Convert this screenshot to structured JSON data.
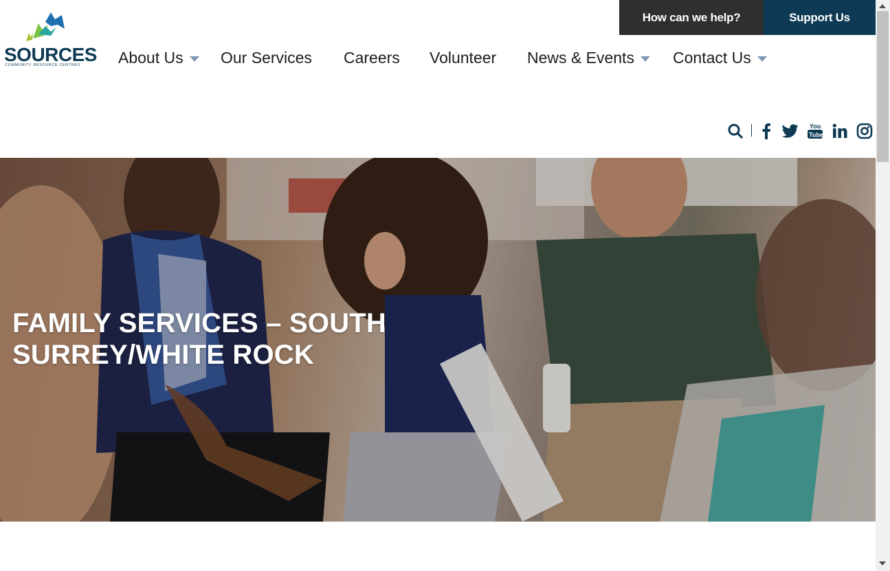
{
  "header": {
    "logo": {
      "name": "SOURCES",
      "tagline": "COMMUNITY RESOURCE CENTRES"
    },
    "top_buttons": {
      "help": "How can we help?",
      "support": "Support Us"
    },
    "nav": [
      {
        "label": "About Us",
        "has_dropdown": true
      },
      {
        "label": "Our Services",
        "has_dropdown": false
      },
      {
        "label": "Careers",
        "has_dropdown": false
      },
      {
        "label": "Volunteer",
        "has_dropdown": false
      },
      {
        "label": "News & Events",
        "has_dropdown": true
      },
      {
        "label": "Contact Us",
        "has_dropdown": true
      }
    ],
    "social_icons": [
      "search-icon",
      "facebook-icon",
      "twitter-icon",
      "youtube-icon",
      "linkedin-icon",
      "instagram-icon"
    ]
  },
  "hero": {
    "title": "FAMILY SERVICES – SOUTH SURREY/WHITE ROCK"
  },
  "colors": {
    "brand_navy": "#0e3a55",
    "dark_button": "#2f2f2f",
    "caret": "#7f99b3",
    "logo_green": "#7ac043",
    "logo_blue": "#1e6fb0",
    "logo_teal": "#2aa6a1"
  }
}
